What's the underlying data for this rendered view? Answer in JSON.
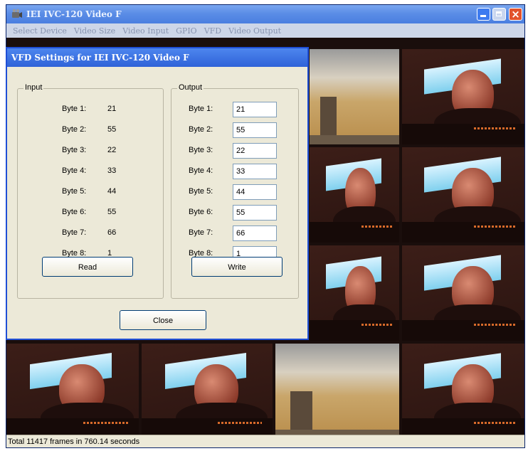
{
  "main": {
    "title": "IEI IVC-120 Video F",
    "menu": [
      "Select Device",
      "Video Size",
      "Video Input",
      "GPIO",
      "VFD",
      "Video Output"
    ],
    "status": "Total 11417 frames in 760.14 seconds"
  },
  "dialog": {
    "title": "VFD Settings for IEI IVC-120 Video F",
    "input": {
      "legend": "Input",
      "rows": [
        {
          "label": "Byte 1:",
          "value": "21"
        },
        {
          "label": "Byte 2:",
          "value": "55"
        },
        {
          "label": "Byte 3:",
          "value": "22"
        },
        {
          "label": "Byte 4:",
          "value": "33"
        },
        {
          "label": "Byte 5:",
          "value": "44"
        },
        {
          "label": "Byte 6:",
          "value": "55"
        },
        {
          "label": "Byte 7:",
          "value": "66"
        },
        {
          "label": "Byte 8:",
          "value": "1"
        }
      ],
      "button": "Read"
    },
    "output": {
      "legend": "Output",
      "rows": [
        {
          "label": "Byte 1:",
          "value": "21"
        },
        {
          "label": "Byte 2:",
          "value": "55"
        },
        {
          "label": "Byte 3:",
          "value": "22"
        },
        {
          "label": "Byte 4:",
          "value": "33"
        },
        {
          "label": "Byte 5:",
          "value": "44"
        },
        {
          "label": "Byte 6:",
          "value": "55"
        },
        {
          "label": "Byte 7:",
          "value": "66"
        },
        {
          "label": "Byte 8:",
          "value": "1"
        }
      ],
      "button": "Write"
    },
    "close_button": "Close"
  },
  "colors": {
    "title_bar": "#4a7fe0",
    "dialog_border": "#1f4fd6",
    "close_button": "#e2522c"
  },
  "icons": [
    "app-camera-icon",
    "minimize-icon",
    "maximize-icon",
    "close-icon"
  ]
}
